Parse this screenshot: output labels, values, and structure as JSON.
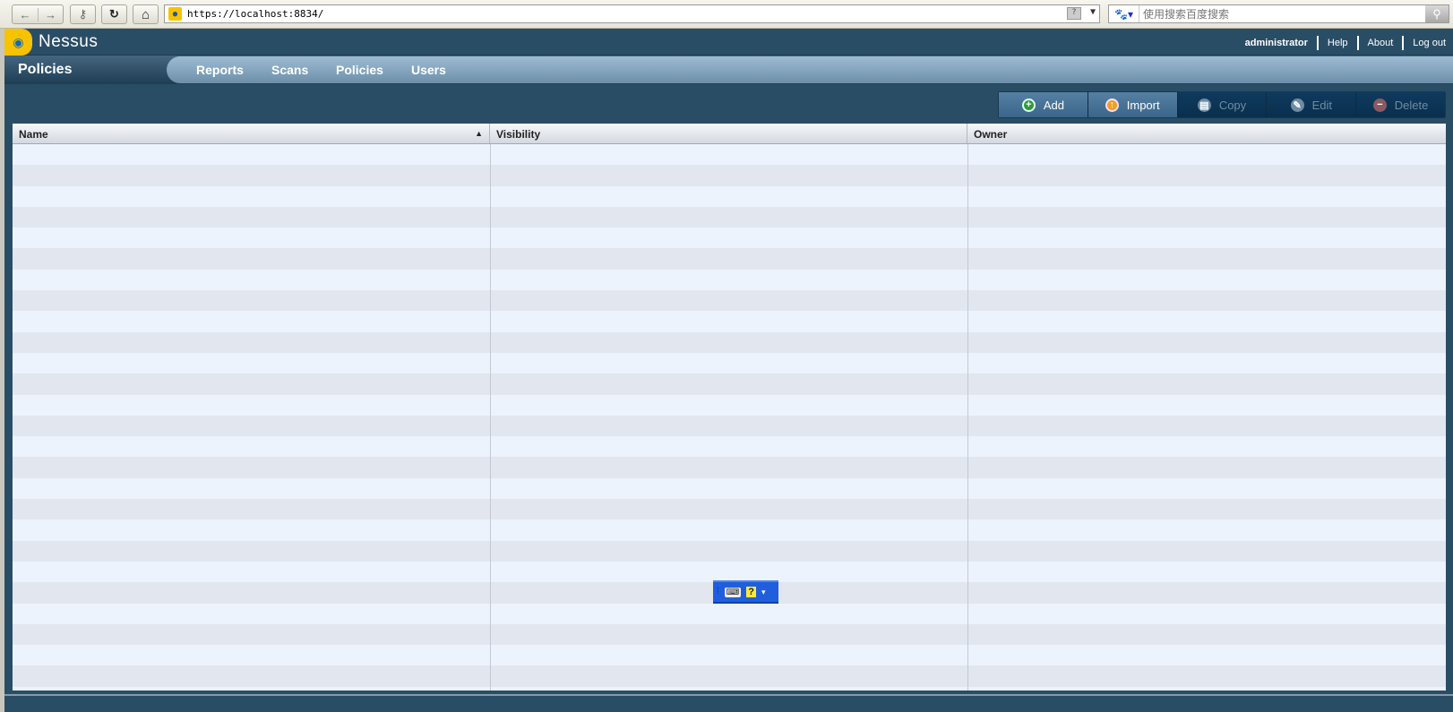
{
  "browser": {
    "url": "https://localhost:8834/",
    "search_placeholder": "使用搜索百度搜索",
    "back_icon": "←",
    "forward_icon": "→",
    "key_icon": "⚷",
    "reload_icon": "↻",
    "home_icon": "⌂"
  },
  "header": {
    "brand": "Nessus",
    "user": "administrator",
    "links": [
      "Help",
      "About",
      "Log out"
    ]
  },
  "nav": {
    "title": "Policies",
    "items": [
      "Reports",
      "Scans",
      "Policies",
      "Users"
    ]
  },
  "toolbar": {
    "add": "Add",
    "import": "Import",
    "copy": "Copy",
    "edit": "Edit",
    "delete": "Delete"
  },
  "table": {
    "columns": [
      "Name",
      "Visibility",
      "Owner"
    ],
    "sort_indicator": "▲",
    "rows": []
  }
}
